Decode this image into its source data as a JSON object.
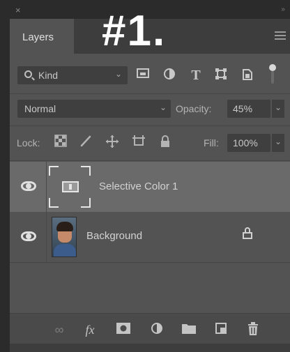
{
  "overlay_label": "#1.",
  "window": {
    "close_glyph": "×",
    "collapse_glyph": "››"
  },
  "panel": {
    "tab_label": "Layers",
    "menu_icon": "hamburger-menu-icon"
  },
  "filter": {
    "kind_label": "Kind",
    "kind_chevron": "⌄",
    "icons": [
      "pixel-layer-filter-icon",
      "adjustment-layer-filter-icon",
      "type-layer-filter-icon",
      "shape-layer-filter-icon",
      "smart-object-filter-icon"
    ],
    "type_glyph": "T"
  },
  "blend": {
    "mode": "Normal",
    "chevron": "⌄",
    "opacity_label": "Opacity:",
    "opacity_value": "45%"
  },
  "lock": {
    "label": "Lock:",
    "icons": [
      "lock-transparent-pixels-icon",
      "lock-image-pixels-icon",
      "lock-position-icon",
      "lock-artboard-icon",
      "lock-all-icon"
    ],
    "fill_label": "Fill:",
    "fill_value": "100%"
  },
  "layers": [
    {
      "name": "Selective Color 1",
      "visible": true,
      "selected": true,
      "thumb": "adjustment-thumbnail"
    },
    {
      "name": "Background",
      "visible": true,
      "selected": false,
      "thumb": "photo-thumbnail",
      "locked": true
    }
  ],
  "footer": {
    "link_glyph": "∞",
    "fx_glyph": "fx",
    "icons": [
      "link-layers-icon",
      "fx-icon",
      "add-mask-icon",
      "new-adjustment-layer-icon",
      "new-group-icon",
      "new-layer-icon",
      "delete-layer-icon"
    ]
  },
  "colors": {
    "panel_bg": "#535353",
    "selected_row": "#6a6a6a",
    "field_bg": "#3f3f3f",
    "app_bg": "#2b2b2b"
  }
}
